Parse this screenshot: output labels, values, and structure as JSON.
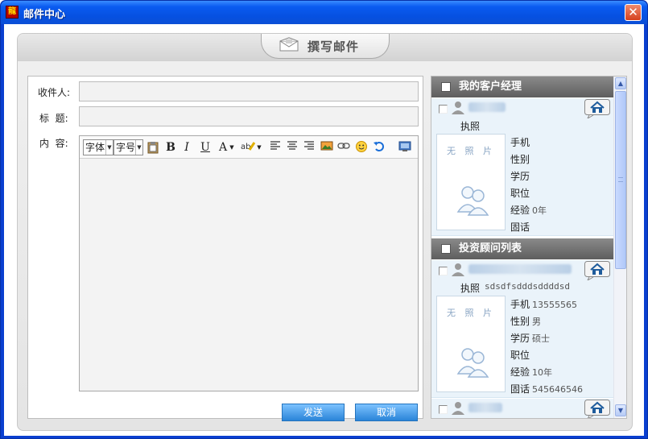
{
  "window": {
    "title": "邮件中心",
    "icon_text": "龍",
    "close": "✕"
  },
  "tab": {
    "label": "撰写邮件"
  },
  "compose": {
    "recipient_label": "收件人:",
    "subject_label": "标  题:",
    "content_label": "内  容:",
    "recipient_value": "",
    "subject_value": "",
    "toolbar": {
      "font_label": "字体",
      "size_label": "字号",
      "bold": "B",
      "italic": "I",
      "underline": "U",
      "font_color": "A"
    },
    "send_label": "发送",
    "cancel_label": "取消"
  },
  "side": {
    "managers_title": "我的客户经理",
    "advisors_title": "投资顾问列表",
    "no_photo": "无 照 片",
    "labels": {
      "license": "执照",
      "mobile": "手机",
      "gender": "性别",
      "education": "学历",
      "position": "职位",
      "experience": "经验",
      "phone": "固话"
    },
    "manager": {
      "license": "",
      "mobile": "",
      "gender": "",
      "education": "",
      "position": "",
      "experience": "0年",
      "phone": ""
    },
    "advisor": {
      "license": "sdsdfsdddsddddsd",
      "mobile": "13555565",
      "gender": "男",
      "education": "硕士",
      "position": "",
      "experience": "10年",
      "phone": "545646546"
    }
  },
  "colors": {
    "titlebar": "#0a5bf0",
    "button": "#3a91e0",
    "section_header": "#6f6f6f",
    "card_bg": "#eaf3fa"
  }
}
